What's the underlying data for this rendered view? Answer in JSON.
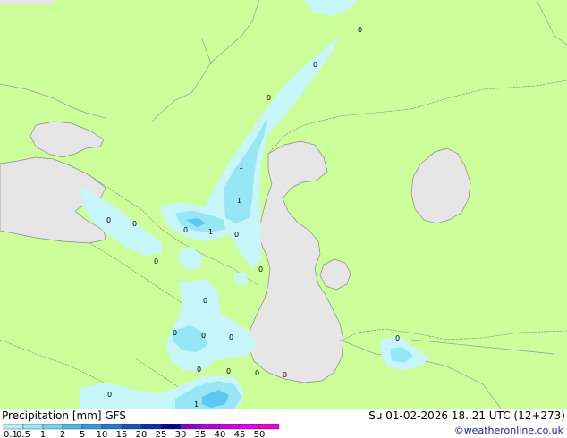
{
  "footer": {
    "title": "Precipitation [mm]  GFS",
    "valid_time": "Su 01-02-2026 18..21 UTC (12+273)",
    "credit": "©weatheronline.co.uk"
  },
  "legend": {
    "ticks": [
      "0.1",
      "0.5",
      "1",
      "2",
      "5",
      "10",
      "15",
      "20",
      "25",
      "30",
      "35",
      "40",
      "45",
      "50"
    ],
    "colors": [
      "#b4f0fa",
      "#96e6f5",
      "#78d2f0",
      "#50b4e6",
      "#3c96dc",
      "#2878d2",
      "#1450be",
      "#0a32aa",
      "#000096",
      "#8c00c8",
      "#b400dc",
      "#d200e6",
      "#e600f0",
      "#f000c8"
    ]
  },
  "map": {
    "land_color": "#ccff99",
    "water_color": "#e6e6e6",
    "precip_light": "#c8f5fa",
    "precip_medium": "#96e6f5",
    "precip_strong": "#5ac8f0",
    "point_labels": [
      "0",
      "0",
      "0",
      "1",
      "1",
      "0",
      "0",
      "1",
      "0",
      "0",
      "0",
      "0",
      "0",
      "0",
      "0",
      "0",
      "0",
      "0",
      "0",
      "0",
      "0",
      "1",
      "0"
    ]
  }
}
